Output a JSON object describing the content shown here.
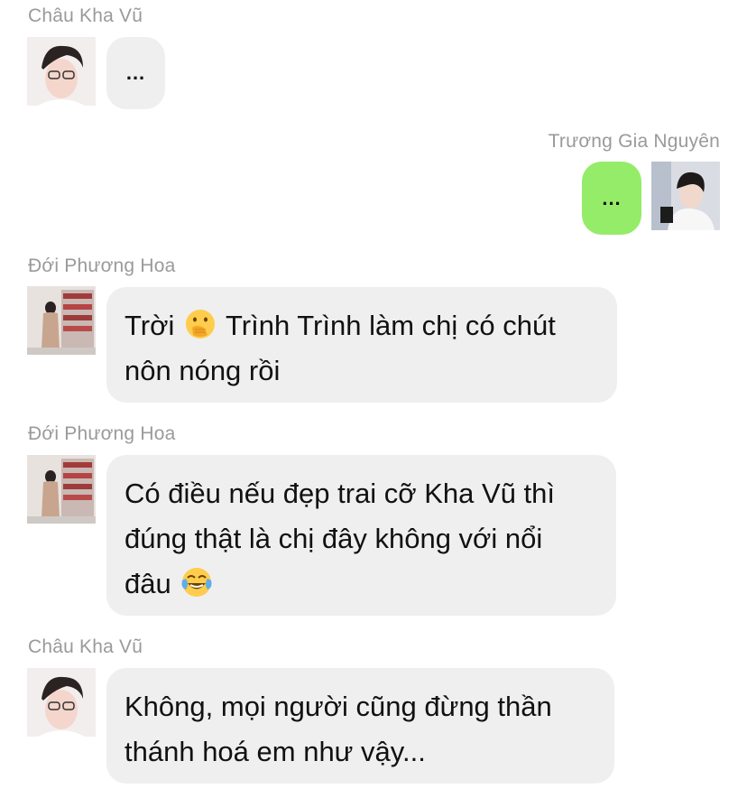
{
  "messages": [
    {
      "sender": "Châu Kha Vũ",
      "side": "left",
      "avatar": "avatar-chau-kha-vu",
      "text": "..."
    },
    {
      "sender": "Trương Gia Nguyên",
      "side": "right",
      "avatar": "avatar-truong-gia-nguyen",
      "text": "..."
    },
    {
      "sender": "Đới Phương Hoa",
      "side": "left",
      "avatar": "avatar-doi-phuong-hoa",
      "text_before_emoji": "Trời",
      "emoji": "face-with-hand-over-mouth",
      "text_after_emoji": "Trình Trình làm chị có chút",
      "text_line2": "nôn nóng rồi"
    },
    {
      "sender": "Đới Phương Hoa",
      "side": "left",
      "avatar": "avatar-doi-phuong-hoa",
      "text_line1": "Có điều nếu đẹp trai cỡ Kha Vũ thì",
      "text_line2": "đúng thật là chị đây không với nổi",
      "text_line3": "đâu",
      "emoji": "face-with-tears-of-joy"
    },
    {
      "sender": "Châu Kha Vũ",
      "side": "left",
      "avatar": "avatar-chau-kha-vu",
      "text_line1": "Không, mọi người cũng đừng thần",
      "text_line2": "thánh hoá em như vậy..."
    }
  ],
  "colors": {
    "sender_name": "#9a9a9a",
    "bubble_incoming": "#efefef",
    "bubble_outgoing": "#95ec69",
    "text": "#111111",
    "background": "#ffffff"
  }
}
